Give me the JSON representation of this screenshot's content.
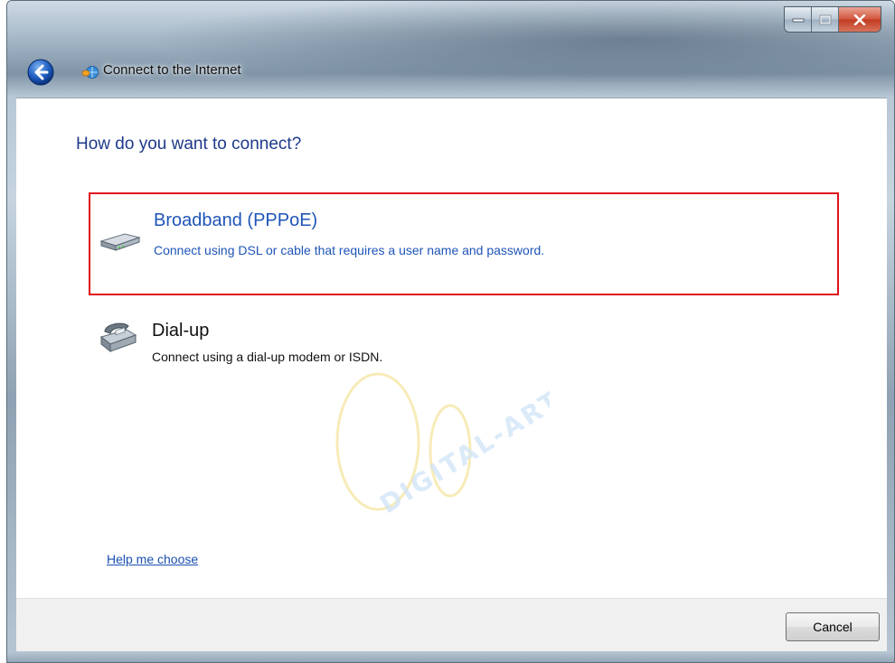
{
  "window": {
    "title": "Connect to the Internet",
    "icons": {
      "back": "back-arrow-icon",
      "title": "network-globe-icon",
      "minimize": "minimize-icon",
      "maximize": "maximize-icon",
      "close": "close-icon"
    },
    "colors": {
      "close_button": "#c03a20",
      "accent": "#1f55b8"
    }
  },
  "main": {
    "heading": "How do you want to connect?",
    "options": [
      {
        "title": "Broadband (PPPoE)",
        "description": "Connect using DSL or cable that requires a user name and password.",
        "icon": "broadband-modem-icon",
        "selected": true
      },
      {
        "title": "Dial-up",
        "description": "Connect using a dial-up modem or ISDN.",
        "icon": "dialup-phone-icon",
        "selected": false
      }
    ],
    "help_link": "Help me choose",
    "watermark": "DIGITAL-ART.IR"
  },
  "footer": {
    "cancel_label": "Cancel"
  },
  "highlight_color": "#e0141f"
}
